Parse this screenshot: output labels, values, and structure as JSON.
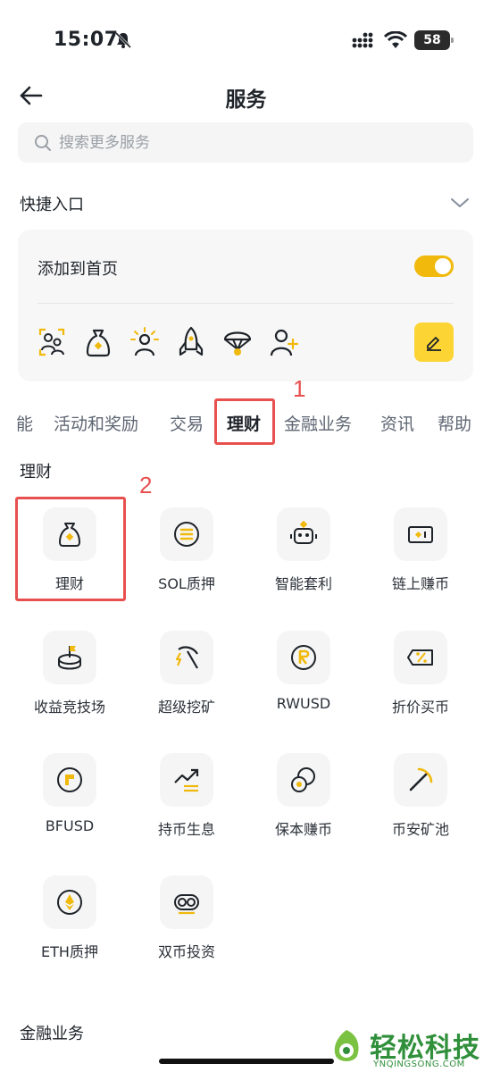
{
  "status_bar": {
    "time": "15:07",
    "battery": "58"
  },
  "nav": {
    "title": "服务"
  },
  "search": {
    "placeholder": "搜索更多服务"
  },
  "quick_entry": {
    "title": "快捷入口",
    "add_to_home_label": "添加到首页",
    "toggle_on": true,
    "icons": [
      "user-switch-icon",
      "finance-bag-icon",
      "sun-person-icon",
      "rocket-icon",
      "parachute-icon",
      "add-user-icon"
    ]
  },
  "tabs": [
    {
      "label": "能",
      "active": false
    },
    {
      "label": "活动和奖励",
      "active": false
    },
    {
      "label": "交易",
      "active": false
    },
    {
      "label": "理财",
      "active": true
    },
    {
      "label": "金融业务",
      "active": false
    },
    {
      "label": "资讯",
      "active": false
    },
    {
      "label": "帮助",
      "active": false
    }
  ],
  "annotations": {
    "one": "1",
    "two": "2",
    "color": "#e8504f"
  },
  "sections": {
    "finance": {
      "title": "理财",
      "items": [
        {
          "label": "理财",
          "icon": "finance-bag-icon"
        },
        {
          "label": "SOL质押",
          "icon": "sol-icon"
        },
        {
          "label": "智能套利",
          "icon": "robot-icon"
        },
        {
          "label": "链上赚币",
          "icon": "onchain-icon"
        },
        {
          "label": "收益竞技场",
          "icon": "arena-icon"
        },
        {
          "label": "超级挖矿",
          "icon": "mining-pickaxe-icon"
        },
        {
          "label": "RWUSD",
          "icon": "rwusd-icon"
        },
        {
          "label": "折价买币",
          "icon": "discount-ticket-icon"
        },
        {
          "label": "BFUSD",
          "icon": "bfusd-icon"
        },
        {
          "label": "持币生息",
          "icon": "growth-chart-icon"
        },
        {
          "label": "保本赚币",
          "icon": "coins-icon"
        },
        {
          "label": "币安矿池",
          "icon": "pickaxe-icon"
        },
        {
          "label": "ETH质押",
          "icon": "eth-icon"
        },
        {
          "label": "双币投资",
          "icon": "dual-coin-icon"
        }
      ]
    },
    "financial_business": {
      "title": "金融业务"
    }
  },
  "watermark": {
    "title": "轻松科技",
    "subtitle": "YNQINGSONG.COM"
  },
  "colors": {
    "accent": "#f0b90b",
    "edit_button": "#fcd535",
    "annotation": "#e8504f",
    "text": "#1e2329"
  }
}
